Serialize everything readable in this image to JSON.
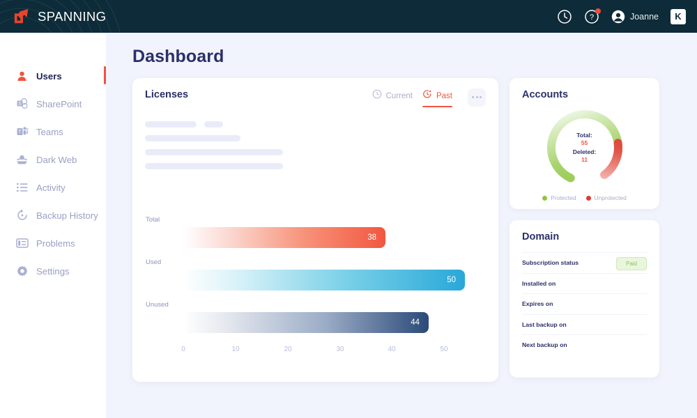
{
  "topbar": {
    "logo_text": "SPANNING",
    "logo_icon": "spanning-arrow-logo",
    "history_icon": "clock-icon",
    "help_icon": "help-circle-icon",
    "avatar_icon": "user-avatar-icon",
    "user_name": "Joanne",
    "app_badge": "K",
    "bg_color": "#0d2b38"
  },
  "sidebar": {
    "items": [
      {
        "label": "Users",
        "icon": "user-icon",
        "active": true
      },
      {
        "label": "SharePoint",
        "icon": "sharepoint-icon",
        "active": false
      },
      {
        "label": "Teams",
        "icon": "teams-icon",
        "active": false
      },
      {
        "label": "Dark Web",
        "icon": "dark-web-icon",
        "active": false
      },
      {
        "label": "Activity",
        "icon": "activity-list-icon",
        "active": false
      },
      {
        "label": "Backup History",
        "icon": "history-restore-icon",
        "active": false
      },
      {
        "label": "Problems",
        "icon": "problems-icon",
        "active": false
      },
      {
        "label": "Settings",
        "icon": "gear-icon",
        "active": false
      }
    ],
    "active_indicator_color": "#f05340"
  },
  "page": {
    "title": "Dashboard",
    "bg_color": "#f2f4fd",
    "accent_color": "#f0563f"
  },
  "licenses": {
    "title": "Licenses",
    "tabs": [
      {
        "label": "Current",
        "icon": "clock-icon",
        "active": false
      },
      {
        "label": "Past",
        "icon": "refresh-clock-icon",
        "active": true
      }
    ],
    "more_menu": "more-options-icon",
    "loading_placeholders": 5
  },
  "chart_data": {
    "type": "bar",
    "orientation": "horizontal",
    "title": "Licenses",
    "categories": [
      "Total",
      "Used",
      "Unused"
    ],
    "values": [
      38,
      50,
      44
    ],
    "xlabel": "",
    "ylabel": "",
    "xlim": [
      0,
      50
    ],
    "xticks": [
      "0",
      "10",
      "20",
      "30",
      "40",
      "50"
    ],
    "grid": false,
    "bar_colors": [
      "#f2573f",
      "#28a8d8",
      "#2b4a79"
    ],
    "value_labels": [
      "38",
      "50",
      "44"
    ]
  },
  "accounts": {
    "title": "Accounts",
    "donut": {
      "type": "pie",
      "center_rows": [
        {
          "label": "Total:",
          "value": "55"
        },
        {
          "label": "Deleted:",
          "value": "11"
        }
      ],
      "segments": [
        {
          "name": "Protected",
          "value": 55,
          "color": "#8cc63f"
        },
        {
          "name": "Unprotected",
          "value": 11,
          "color": "#e03b2f"
        }
      ]
    },
    "legend": [
      {
        "label": "Protected",
        "color": "#8cc63f"
      },
      {
        "label": "Unprotected",
        "color": "#e03b2f"
      }
    ]
  },
  "domain": {
    "title": "Domain",
    "rows": [
      {
        "label": "Subscription status",
        "badge": "Paid",
        "value": null
      },
      {
        "label": "Installed on",
        "badge": null,
        "value": null
      },
      {
        "label": "Expires on",
        "badge": null,
        "value": null
      },
      {
        "label": "Last backup on",
        "badge": null,
        "value": null
      },
      {
        "label": "Next backup on",
        "badge": null,
        "value": null
      }
    ]
  }
}
